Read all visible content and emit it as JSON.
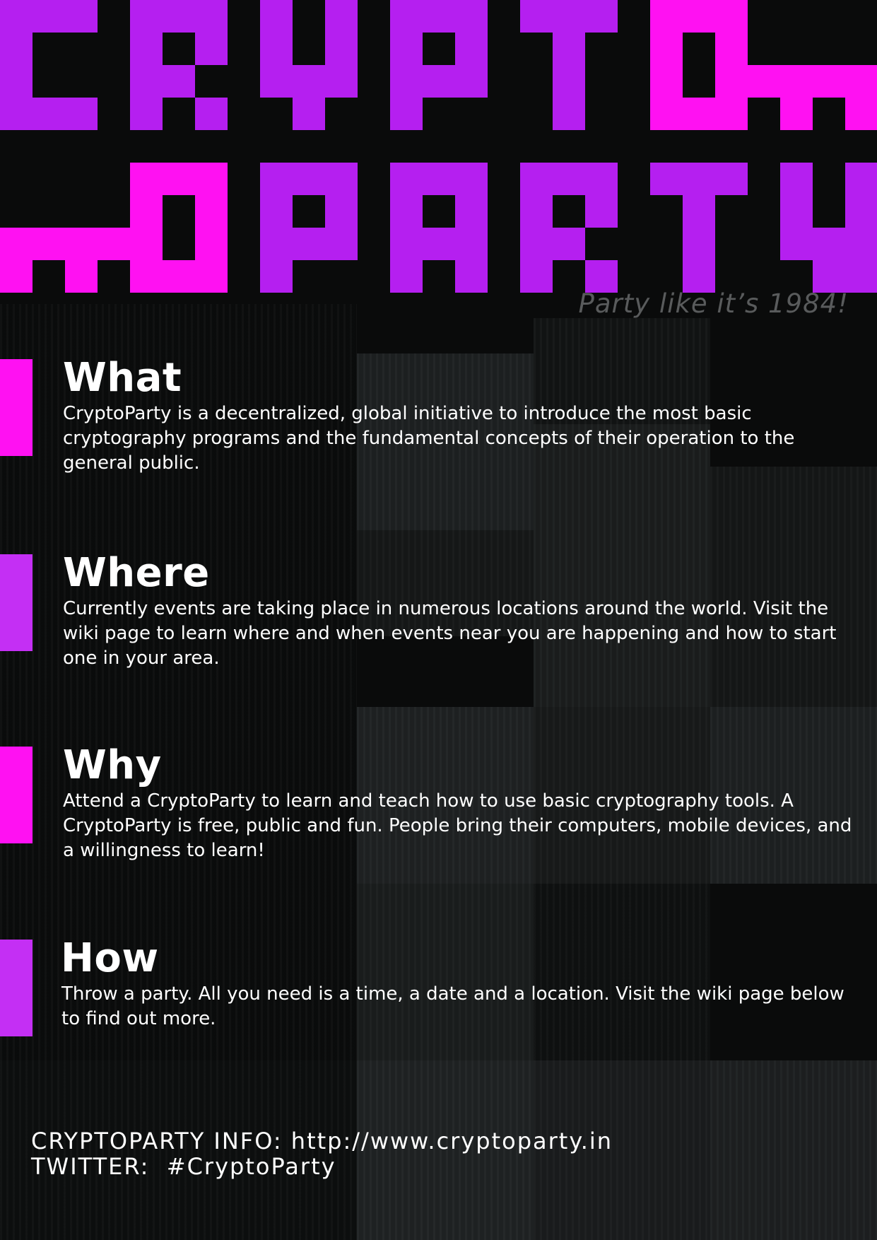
{
  "title": {
    "line1": "CRYPTO",
    "line2": "PARTY",
    "colors": {
      "purple": "#b51ff0",
      "magenta": "#ff11f2"
    }
  },
  "tagline": "Party like it’s 1984!",
  "sections": [
    {
      "heading": "What",
      "body": "CryptoParty is a decentralized, global initiative to introduce the most basic cryptography programs and the fundamental concepts of their operation to the general public.",
      "accent": "#ff11f2"
    },
    {
      "heading": "Where",
      "body": "Currently events are taking place in numerous locations around the world. Visit the wiki page to learn where and when events near you are happening and how to start one in your area.",
      "accent": "#c42ff4"
    },
    {
      "heading": "Why",
      "body": "Attend a CryptoParty to learn and teach how to use basic cryptography tools. A CryptoParty is free, public and fun. People bring their computers, mobile devices, and a willingness to learn!",
      "accent": "#ff11f2"
    },
    {
      "heading": "How",
      "body": "Throw a party. All you need is a time, a date and a location. Visit the wiki page below to find out more.",
      "accent": "#c42ff4"
    }
  ],
  "footer": {
    "info": "CRYPTOPARTY INFO: http://www.cryptoparty.in",
    "twitter": "TWITTER:  #CryptoParty"
  },
  "colors": {
    "background": "#0a0b0b",
    "tagline": "#595b5c",
    "text": "#ffffff"
  }
}
